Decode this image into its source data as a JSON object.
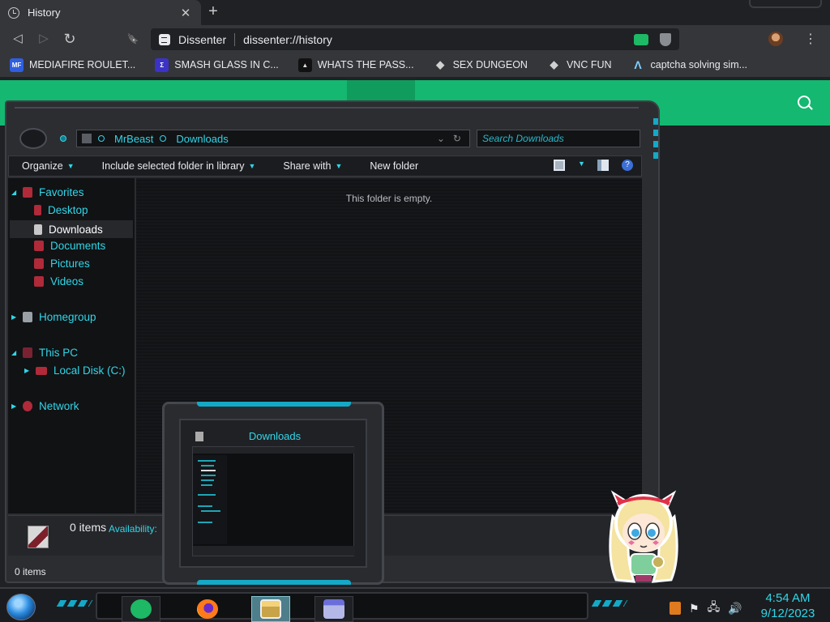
{
  "browser": {
    "tab": {
      "title": "History",
      "close": "✕"
    },
    "new_tab": "+",
    "nav": {
      "back": "◁",
      "forward": "▷",
      "reload": "↻",
      "bookmark": "🔖"
    },
    "omnibox": {
      "site": "Dissenter",
      "url": "dissenter://history"
    },
    "menu": "⋮",
    "bookmarks": [
      {
        "label": "MEDIAFIRE ROULET...",
        "icon": "mediafire-icon",
        "badge": "MF",
        "color": "#2f5fe0"
      },
      {
        "label": "SMASH GLASS IN C...",
        "icon": "smash-icon",
        "badge": "Σ",
        "color": "#3b33c7"
      },
      {
        "label": "WHATS THE PASS...",
        "icon": "pass-icon",
        "badge": "▲",
        "color": "#111111"
      },
      {
        "label": "SEX DUNGEON",
        "icon": "dungeon-icon",
        "badge": "◆",
        "color": "#d0d0d0"
      },
      {
        "label": "VNC FUN",
        "icon": "vnc-icon",
        "badge": "◆",
        "color": "#d0d0d0"
      },
      {
        "label": "captcha solving sim...",
        "icon": "captcha-icon",
        "badge": "Λ",
        "color": "#35363a"
      }
    ]
  },
  "page": {
    "accent": "#14b870"
  },
  "explorer": {
    "breadcrumb": [
      "MrBeast",
      "Downloads"
    ],
    "search_placeholder": "Search Downloads",
    "commands": [
      {
        "label": "Organize",
        "dropdown": true
      },
      {
        "label": "Include selected folder in library",
        "dropdown": true
      },
      {
        "label": "Share with",
        "dropdown": true
      },
      {
        "label": "New folder",
        "dropdown": false
      }
    ],
    "empty_message": "This folder is empty.",
    "tree": {
      "favorites": "Favorites",
      "desktop": "Desktop",
      "downloads": "Downloads",
      "documents": "Documents",
      "pictures": "Pictures",
      "videos": "Videos",
      "homegroup": "Homegroup",
      "this_pc": "This PC",
      "local_disk": "Local Disk (C:)",
      "network": "Network"
    },
    "details": {
      "count": "0 items",
      "availability": "Availability:"
    },
    "status": "0 items",
    "accent": "#30d6e8"
  },
  "thumbnail": {
    "title": "Downloads"
  },
  "taskbar": {
    "time": "4:54 AM",
    "date": "9/12/2023"
  }
}
